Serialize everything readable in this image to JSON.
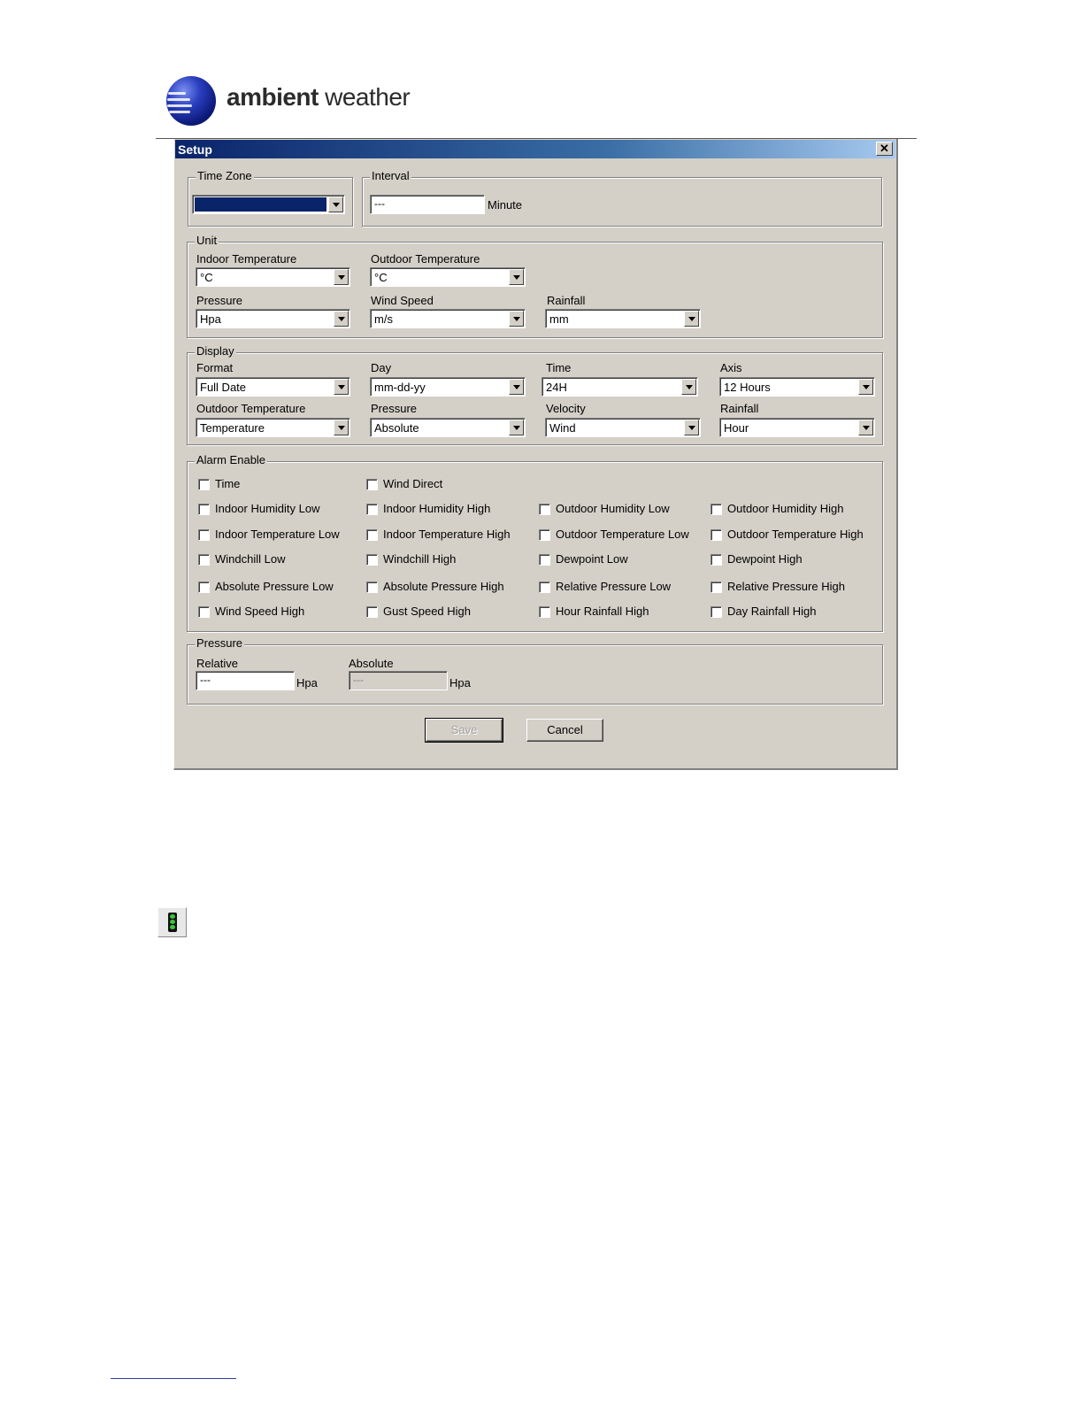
{
  "logo": {
    "bold": "ambient",
    "rest": " weather"
  },
  "dialog": {
    "title": "Setup",
    "close_glyph": "✕",
    "timezone": {
      "group": "Time Zone",
      "value": ""
    },
    "interval": {
      "group": "Interval",
      "value": "---",
      "unit": "Minute"
    },
    "unit": {
      "group": "Unit",
      "indoor_temp": {
        "label": "Indoor Temperature",
        "value": "°C"
      },
      "outdoor_temp": {
        "label": "Outdoor Temperature",
        "value": "°C"
      },
      "pressure": {
        "label": "Pressure",
        "value": "Hpa"
      },
      "wind_speed": {
        "label": "Wind Speed",
        "value": "m/s"
      },
      "rainfall": {
        "label": "Rainfall",
        "value": "mm"
      }
    },
    "display": {
      "group": "Display",
      "format": {
        "label": "Format",
        "value": "Full Date"
      },
      "day": {
        "label": "Day",
        "value": "mm-dd-yy"
      },
      "time": {
        "label": "Time",
        "value": "24H"
      },
      "axis": {
        "label": "Axis",
        "value": "12 Hours"
      },
      "outdoor_temp": {
        "label": "Outdoor Temperature",
        "value": "Temperature"
      },
      "pressure": {
        "label": "Pressure",
        "value": "Absolute"
      },
      "velocity": {
        "label": "Velocity",
        "value": "Wind"
      },
      "rainfall": {
        "label": "Rainfall",
        "value": "Hour"
      }
    },
    "alarm": {
      "group": "Alarm Enable",
      "items": [
        "Time",
        "Wind Direct",
        "Indoor Humidity Low",
        "Indoor Humidity High",
        "Outdoor Humidity Low",
        "Outdoor Humidity High",
        "Indoor Temperature Low",
        "Indoor Temperature High",
        "Outdoor Temperature Low",
        "Outdoor Temperature High",
        "Windchill Low",
        "Windchill High",
        "Dewpoint Low",
        "Dewpoint High",
        "Absolute Pressure Low",
        "Absolute Pressure High",
        "Relative Pressure Low",
        "Relative Pressure High",
        "Wind Speed High",
        "Gust Speed High",
        "Hour Rainfall High",
        "Day Rainfall High"
      ]
    },
    "pressure": {
      "group": "Pressure",
      "relative": {
        "label": "Relative",
        "value": "---",
        "unit": "Hpa"
      },
      "absolute": {
        "label": "Absolute",
        "value": "---",
        "unit": "Hpa"
      }
    },
    "buttons": {
      "save": "Save",
      "cancel": "Cancel"
    }
  },
  "icons": {
    "traffic_light": "traffic-light-icon"
  },
  "colors": {
    "title_start": "#0a246a",
    "title_end": "#a6caf0",
    "face": "#d4d0c8"
  }
}
